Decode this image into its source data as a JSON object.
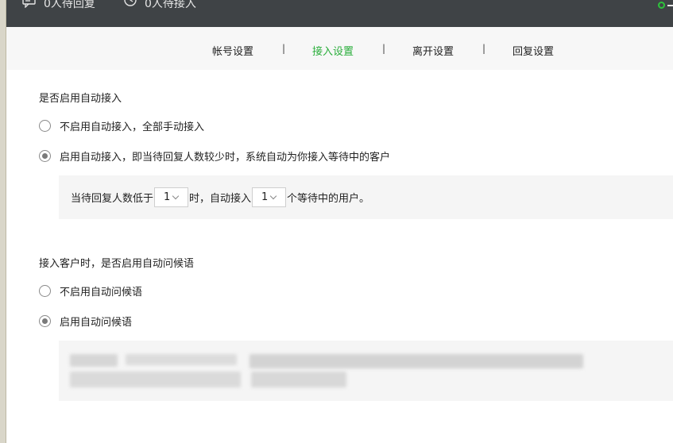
{
  "topbar": {
    "pending_reply": "0人待回复",
    "pending_accept": "0人待接入"
  },
  "tabs": [
    {
      "label": "帐号设置",
      "active": false
    },
    {
      "label": "接入设置",
      "active": true
    },
    {
      "label": "离开设置",
      "active": false
    },
    {
      "label": "回复设置",
      "active": false
    }
  ],
  "separator": "|",
  "auto_accept": {
    "title": "是否启用自动接入",
    "options": [
      {
        "label": "不启用自动接入，全部手动接入",
        "checked": false
      },
      {
        "label": "启用自动接入，即当待回复人数较少时，系统自动为你接入等待中的客户",
        "checked": true
      }
    ],
    "rule": {
      "prefix": "当待回复人数低于",
      "threshold": "1",
      "middle": "时，自动接入",
      "count": "1",
      "suffix": "个等待中的用户。"
    }
  },
  "greeting": {
    "title": "接入客户时，是否启用自动问候语",
    "options": [
      {
        "label": "不启用自动问候语",
        "checked": false
      },
      {
        "label": "启用自动问候语",
        "checked": true
      }
    ]
  },
  "colors": {
    "topbar_bg": "#3f4346",
    "accent": "#2aae3b",
    "status_online": "#2dc43b"
  }
}
